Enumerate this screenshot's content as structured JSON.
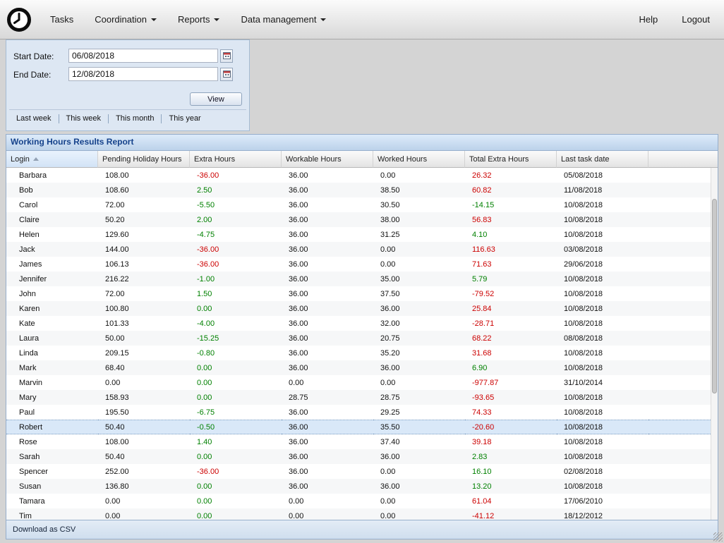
{
  "nav": {
    "menu_items": [
      {
        "label": "Tasks",
        "has_dropdown": false
      },
      {
        "label": "Coordination",
        "has_dropdown": true
      },
      {
        "label": "Reports",
        "has_dropdown": true
      },
      {
        "label": "Data management",
        "has_dropdown": true
      }
    ],
    "right_items": [
      {
        "label": "Help"
      },
      {
        "label": "Logout"
      }
    ]
  },
  "filter_panel": {
    "start_date": {
      "label": "Start Date:",
      "value": "06/08/2018"
    },
    "end_date": {
      "label": "End Date:",
      "value": "12/08/2018"
    },
    "view_button_label": "View",
    "quick_links": [
      "Last week",
      "This week",
      "This month",
      "This year"
    ]
  },
  "report": {
    "title": "Working Hours Results Report",
    "columns": [
      "Login",
      "Pending Holiday Hours",
      "Extra Hours",
      "Workable Hours",
      "Worked Hours",
      "Total Extra Hours",
      "Last task date"
    ],
    "sort": {
      "column": "Login",
      "direction": "ascending"
    },
    "footer_link": "Download as CSV",
    "rows": [
      {
        "login": "Barbara",
        "pending_holiday_hours": "108.00",
        "extra_hours": "-36.00",
        "extra_hours_color": "negative",
        "workable_hours": "36.00",
        "worked_hours": "0.00",
        "total_extra_hours": "26.32",
        "total_extra_hours_color": "negative",
        "last_task_date": "05/08/2018",
        "selected": false
      },
      {
        "login": "Bob",
        "pending_holiday_hours": "108.60",
        "extra_hours": "2.50",
        "extra_hours_color": "positive",
        "workable_hours": "36.00",
        "worked_hours": "38.50",
        "total_extra_hours": "60.82",
        "total_extra_hours_color": "negative",
        "last_task_date": "11/08/2018",
        "selected": false
      },
      {
        "login": "Carol",
        "pending_holiday_hours": "72.00",
        "extra_hours": "-5.50",
        "extra_hours_color": "positive",
        "workable_hours": "36.00",
        "worked_hours": "30.50",
        "total_extra_hours": "-14.15",
        "total_extra_hours_color": "positive",
        "last_task_date": "10/08/2018",
        "selected": false
      },
      {
        "login": "Claire",
        "pending_holiday_hours": "50.20",
        "extra_hours": "2.00",
        "extra_hours_color": "positive",
        "workable_hours": "36.00",
        "worked_hours": "38.00",
        "total_extra_hours": "56.83",
        "total_extra_hours_color": "negative",
        "last_task_date": "10/08/2018",
        "selected": false
      },
      {
        "login": "Helen",
        "pending_holiday_hours": "129.60",
        "extra_hours": "-4.75",
        "extra_hours_color": "positive",
        "workable_hours": "36.00",
        "worked_hours": "31.25",
        "total_extra_hours": "4.10",
        "total_extra_hours_color": "positive",
        "last_task_date": "10/08/2018",
        "selected": false
      },
      {
        "login": "Jack",
        "pending_holiday_hours": "144.00",
        "extra_hours": "-36.00",
        "extra_hours_color": "negative",
        "workable_hours": "36.00",
        "worked_hours": "0.00",
        "total_extra_hours": "116.63",
        "total_extra_hours_color": "negative",
        "last_task_date": "03/08/2018",
        "selected": false
      },
      {
        "login": "James",
        "pending_holiday_hours": "106.13",
        "extra_hours": "-36.00",
        "extra_hours_color": "negative",
        "workable_hours": "36.00",
        "worked_hours": "0.00",
        "total_extra_hours": "71.63",
        "total_extra_hours_color": "negative",
        "last_task_date": "29/06/2018",
        "selected": false
      },
      {
        "login": "Jennifer",
        "pending_holiday_hours": "216.22",
        "extra_hours": "-1.00",
        "extra_hours_color": "positive",
        "workable_hours": "36.00",
        "worked_hours": "35.00",
        "total_extra_hours": "5.79",
        "total_extra_hours_color": "positive",
        "last_task_date": "10/08/2018",
        "selected": false
      },
      {
        "login": "John",
        "pending_holiday_hours": "72.00",
        "extra_hours": "1.50",
        "extra_hours_color": "positive",
        "workable_hours": "36.00",
        "worked_hours": "37.50",
        "total_extra_hours": "-79.52",
        "total_extra_hours_color": "negative",
        "last_task_date": "10/08/2018",
        "selected": false
      },
      {
        "login": "Karen",
        "pending_holiday_hours": "100.80",
        "extra_hours": "0.00",
        "extra_hours_color": "positive",
        "workable_hours": "36.00",
        "worked_hours": "36.00",
        "total_extra_hours": "25.84",
        "total_extra_hours_color": "negative",
        "last_task_date": "10/08/2018",
        "selected": false
      },
      {
        "login": "Kate",
        "pending_holiday_hours": "101.33",
        "extra_hours": "-4.00",
        "extra_hours_color": "positive",
        "workable_hours": "36.00",
        "worked_hours": "32.00",
        "total_extra_hours": "-28.71",
        "total_extra_hours_color": "negative",
        "last_task_date": "10/08/2018",
        "selected": false
      },
      {
        "login": "Laura",
        "pending_holiday_hours": "50.00",
        "extra_hours": "-15.25",
        "extra_hours_color": "positive",
        "workable_hours": "36.00",
        "worked_hours": "20.75",
        "total_extra_hours": "68.22",
        "total_extra_hours_color": "negative",
        "last_task_date": "08/08/2018",
        "selected": false
      },
      {
        "login": "Linda",
        "pending_holiday_hours": "209.15",
        "extra_hours": "-0.80",
        "extra_hours_color": "positive",
        "workable_hours": "36.00",
        "worked_hours": "35.20",
        "total_extra_hours": "31.68",
        "total_extra_hours_color": "negative",
        "last_task_date": "10/08/2018",
        "selected": false
      },
      {
        "login": "Mark",
        "pending_holiday_hours": "68.40",
        "extra_hours": "0.00",
        "extra_hours_color": "positive",
        "workable_hours": "36.00",
        "worked_hours": "36.00",
        "total_extra_hours": "6.90",
        "total_extra_hours_color": "positive",
        "last_task_date": "10/08/2018",
        "selected": false
      },
      {
        "login": "Marvin",
        "pending_holiday_hours": "0.00",
        "extra_hours": "0.00",
        "extra_hours_color": "positive",
        "workable_hours": "0.00",
        "worked_hours": "0.00",
        "total_extra_hours": "-977.87",
        "total_extra_hours_color": "negative",
        "last_task_date": "31/10/2014",
        "selected": false
      },
      {
        "login": "Mary",
        "pending_holiday_hours": "158.93",
        "extra_hours": "0.00",
        "extra_hours_color": "positive",
        "workable_hours": "28.75",
        "worked_hours": "28.75",
        "total_extra_hours": "-93.65",
        "total_extra_hours_color": "negative",
        "last_task_date": "10/08/2018",
        "selected": false
      },
      {
        "login": "Paul",
        "pending_holiday_hours": "195.50",
        "extra_hours": "-6.75",
        "extra_hours_color": "positive",
        "workable_hours": "36.00",
        "worked_hours": "29.25",
        "total_extra_hours": "74.33",
        "total_extra_hours_color": "negative",
        "last_task_date": "10/08/2018",
        "selected": false
      },
      {
        "login": "Robert",
        "pending_holiday_hours": "50.40",
        "extra_hours": "-0.50",
        "extra_hours_color": "positive",
        "workable_hours": "36.00",
        "worked_hours": "35.50",
        "total_extra_hours": "-20.60",
        "total_extra_hours_color": "negative",
        "last_task_date": "10/08/2018",
        "selected": true
      },
      {
        "login": "Rose",
        "pending_holiday_hours": "108.00",
        "extra_hours": "1.40",
        "extra_hours_color": "positive",
        "workable_hours": "36.00",
        "worked_hours": "37.40",
        "total_extra_hours": "39.18",
        "total_extra_hours_color": "negative",
        "last_task_date": "10/08/2018",
        "selected": false
      },
      {
        "login": "Sarah",
        "pending_holiday_hours": "50.40",
        "extra_hours": "0.00",
        "extra_hours_color": "positive",
        "workable_hours": "36.00",
        "worked_hours": "36.00",
        "total_extra_hours": "2.83",
        "total_extra_hours_color": "positive",
        "last_task_date": "10/08/2018",
        "selected": false
      },
      {
        "login": "Spencer",
        "pending_holiday_hours": "252.00",
        "extra_hours": "-36.00",
        "extra_hours_color": "negative",
        "workable_hours": "36.00",
        "worked_hours": "0.00",
        "total_extra_hours": "16.10",
        "total_extra_hours_color": "positive",
        "last_task_date": "02/08/2018",
        "selected": false
      },
      {
        "login": "Susan",
        "pending_holiday_hours": "136.80",
        "extra_hours": "0.00",
        "extra_hours_color": "positive",
        "workable_hours": "36.00",
        "worked_hours": "36.00",
        "total_extra_hours": "13.20",
        "total_extra_hours_color": "positive",
        "last_task_date": "10/08/2018",
        "selected": false
      },
      {
        "login": "Tamara",
        "pending_holiday_hours": "0.00",
        "extra_hours": "0.00",
        "extra_hours_color": "positive",
        "workable_hours": "0.00",
        "worked_hours": "0.00",
        "total_extra_hours": "61.04",
        "total_extra_hours_color": "negative",
        "last_task_date": "17/06/2010",
        "selected": false
      },
      {
        "login": "Tim",
        "pending_holiday_hours": "0.00",
        "extra_hours": "0.00",
        "extra_hours_color": "positive",
        "workable_hours": "0.00",
        "worked_hours": "0.00",
        "total_extra_hours": "-41.12",
        "total_extra_hours_color": "negative",
        "last_task_date": "18/12/2012",
        "selected": false
      }
    ]
  },
  "colors": {
    "negative_value": "#cc0000",
    "positive_value": "#008000",
    "selected_row_bg": "#d9e8f8",
    "title_text": "#15428b"
  }
}
